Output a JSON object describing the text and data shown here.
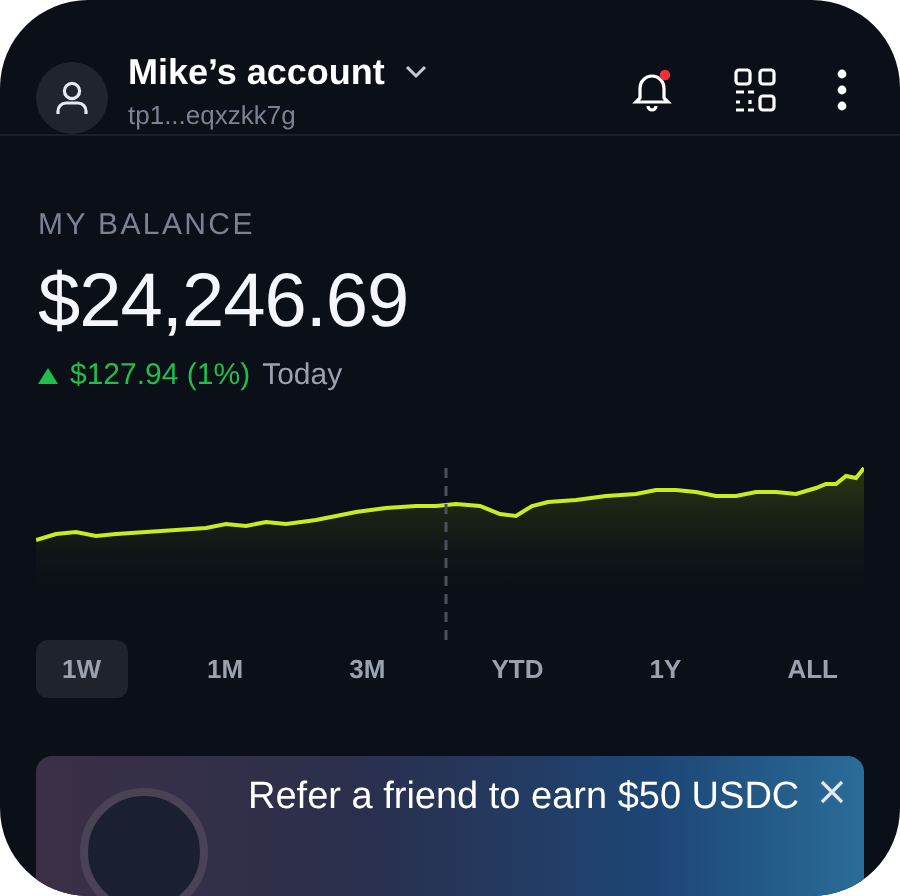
{
  "header": {
    "account_name": "Mike’s account",
    "address": "tp1...eqxzkk7g",
    "has_notification": true
  },
  "balance": {
    "label": "MY BALANCE",
    "amount": "$24,246.69",
    "change": "$127.94 (1%)",
    "rising": true,
    "period": "Today"
  },
  "ranges": [
    {
      "label": "1W",
      "selected": true
    },
    {
      "label": "1M",
      "selected": false
    },
    {
      "label": "3M",
      "selected": false
    },
    {
      "label": "YTD",
      "selected": false
    },
    {
      "label": "1Y",
      "selected": false
    },
    {
      "label": "ALL",
      "selected": false
    }
  ],
  "banner": {
    "text": "Refer a friend to earn $50 USDC"
  }
}
